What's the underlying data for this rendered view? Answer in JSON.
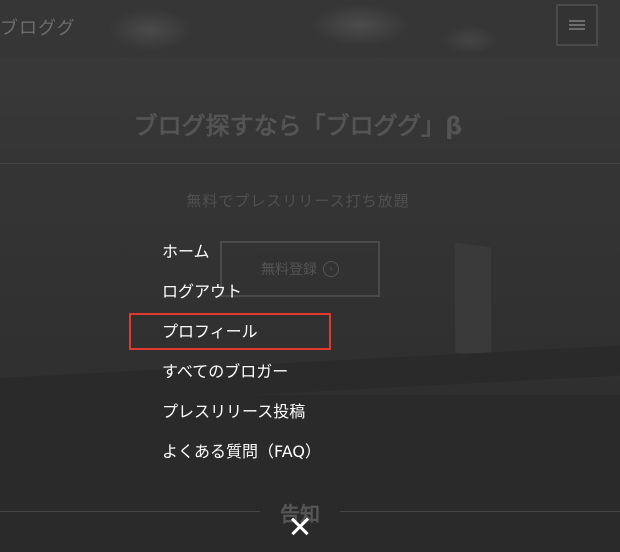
{
  "header": {
    "logo": "ブロググ"
  },
  "hero": {
    "title": "ブログ探すなら「ブロググ」β",
    "subtitle": "無料でプレスリリース打ち放題",
    "cta_label": "無料登録"
  },
  "section": {
    "notice_title": "告知"
  },
  "menu": {
    "items": [
      {
        "label": "ホーム"
      },
      {
        "label": "ログアウト"
      },
      {
        "label": "プロフィール"
      },
      {
        "label": "すべてのブロガー"
      },
      {
        "label": "プレスリリース投稿"
      },
      {
        "label": "よくある質問（FAQ）"
      }
    ],
    "highlighted_index": 2
  },
  "colors": {
    "highlight_border": "#e03a2f",
    "menu_text": "#ffffff",
    "overlay_bg": "#2a2a2a"
  },
  "icons": {
    "menu": "hamburger-icon",
    "close": "close-icon",
    "cta": "arrow-circle-icon"
  }
}
